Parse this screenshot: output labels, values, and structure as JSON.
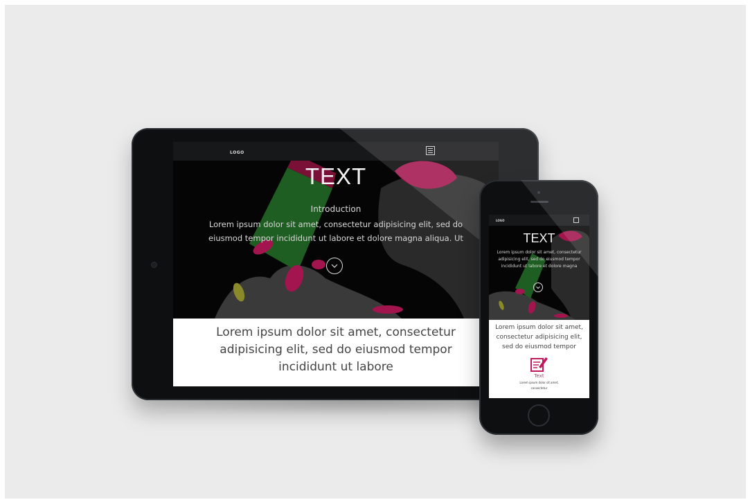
{
  "tablet": {
    "nav": {
      "logo": "LOGO",
      "menu_icon": "menu-grid-icon"
    },
    "hero": {
      "title": "TEXT",
      "intro_heading": "Introduction",
      "intro_text": "Lorem ipsum dolor sit amet, consectetur adipisicing elit, sed do eiusmod tempor incididunt ut labore et dolore magna aliqua. Ut",
      "scroll_icon": "chevron-down-circle-icon"
    },
    "section": {
      "text": "Lorem ipsum dolor sit amet, consectetur adipisicing elit, sed do eiusmod tempor incididunt ut labore"
    }
  },
  "phone": {
    "nav": {
      "logo": "LOGO",
      "menu_icon": "menu-grid-icon"
    },
    "hero": {
      "title": "TEXT",
      "intro_text": "Lorem ipsum dolor sit amet, consectetur adipisicing elit, sed do eiusmod tempor incididunt ut labore et dolore magna",
      "scroll_icon": "chevron-down-circle-icon"
    },
    "section": {
      "text": "Lorem ipsum dolor sit amet, consectetur adipisicing elit, sed do eiusmod tempor",
      "feature_icon": "pencil-notepad-icon",
      "feature_title": "Text",
      "feature_text": "Lorem ipsum dolor sit amet, consectetur"
    }
  },
  "colors": {
    "background": "#ebebeb",
    "device_body": "#0e0f11",
    "accent_pink": "#c2185b",
    "accent_green": "#2e7d32"
  }
}
